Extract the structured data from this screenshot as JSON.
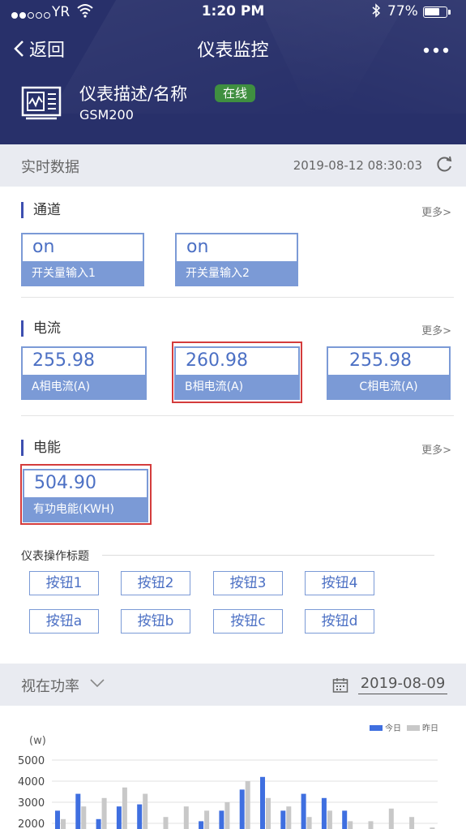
{
  "status": {
    "carrier": "YR",
    "time": "1:20 PM",
    "battery_text": "77%",
    "battery_level": 0.77
  },
  "nav": {
    "back_label": "返回",
    "title": "仪表监控"
  },
  "device": {
    "name": "仪表描述/名称",
    "status": "在线",
    "model": "GSM200"
  },
  "realtime": {
    "label": "实时数据",
    "timestamp": "2019-08-12 08:30:03"
  },
  "channel": {
    "title": "通道",
    "more": "更多>",
    "cards": [
      {
        "value": "on",
        "label": "开关量输入1"
      },
      {
        "value": "on",
        "label": "开关量输入2"
      }
    ]
  },
  "current": {
    "title": "电流",
    "more": "更多>",
    "cards": [
      {
        "value": "255.98",
        "label": "A相电流(A)"
      },
      {
        "value": "260.98",
        "label": "B相电流(A)"
      },
      {
        "value": "255.98",
        "label": "C相电流(A)"
      }
    ]
  },
  "energy": {
    "title": "电能",
    "more": "更多>",
    "cards": [
      {
        "value": "504.90",
        "label": "有功电能(KWH)"
      }
    ]
  },
  "ops": {
    "title": "仪表操作标题",
    "buttons": [
      "按钮1",
      "按钮2",
      "按钮3",
      "按钮4",
      "按钮a",
      "按钮b",
      "按钮c",
      "按钮d"
    ]
  },
  "power": {
    "label": "视在功率",
    "date": "2019-08-09"
  },
  "colors": {
    "header_bg": "#28306a",
    "accent": "#4c70c4",
    "card_label_bg": "#7b9ad6",
    "online": "#3f8f40",
    "today": "#3f6fe0",
    "yesterday": "#c8c8c8"
  },
  "chart_data": {
    "type": "bar",
    "ylabel": "(w)",
    "yticks": [
      5000,
      4000,
      3000,
      2000
    ],
    "ylim": [
      1000,
      5000
    ],
    "legend": [
      "今日",
      "昨日"
    ],
    "legend_position": "top-right",
    "grid": true,
    "series": [
      {
        "name": "今日",
        "values": [
          2600,
          3400,
          2200,
          2800,
          2900,
          1000,
          1000,
          2100,
          2600,
          3600,
          4200,
          2600,
          3400,
          3200,
          2600,
          1000,
          1000,
          1000,
          1000
        ]
      },
      {
        "name": "昨日",
        "values": [
          2200,
          2800,
          3200,
          3700,
          3400,
          2300,
          2800,
          2600,
          3000,
          4000,
          3200,
          2800,
          2300,
          2600,
          2100,
          2100,
          2700,
          2300,
          1800
        ]
      }
    ]
  }
}
